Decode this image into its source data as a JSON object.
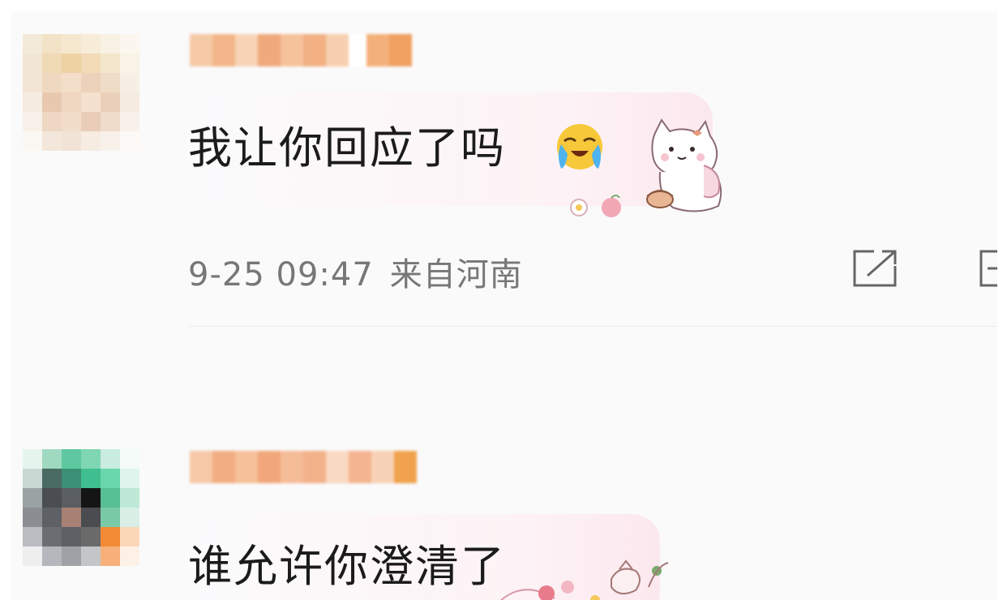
{
  "comments": [
    {
      "message": "我让你回应了吗",
      "emoji": "loudly-crying-face",
      "sticker": "white-cat-sticker",
      "time": "9-25 09:47",
      "location": "来自河南",
      "actions": [
        "share-icon",
        "more-icon"
      ]
    },
    {
      "message": "谁允许你澄清了",
      "sticker": "floral-teapot-sticker"
    }
  ],
  "colors": {
    "background": "#fafafb",
    "text": "#1b1b1b",
    "meta": "#777777",
    "bubble": "#fdf3f6"
  }
}
